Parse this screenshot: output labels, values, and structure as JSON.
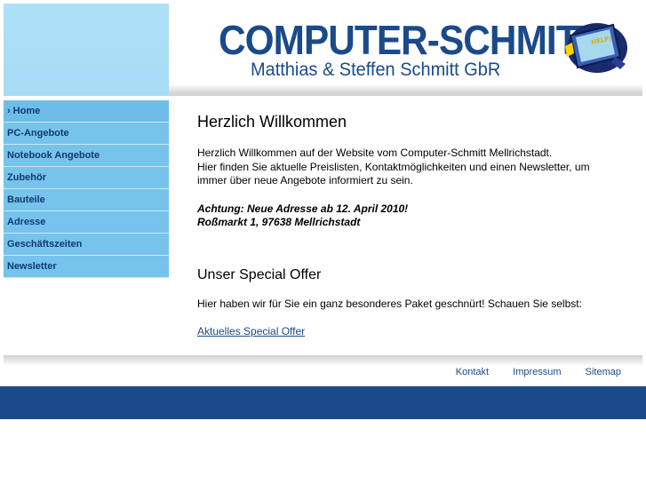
{
  "header": {
    "logo_title": "COMPUTER-SCHMITT",
    "logo_subtitle": "Matthias & Steffen Schmitt GbR",
    "mascot_label": "HELP!",
    "mascot_icon": "computer-mascot-icon"
  },
  "nav": {
    "items": [
      {
        "label": "Home",
        "active": true
      },
      {
        "label": "PC-Angebote"
      },
      {
        "label": "Notebook Angebote"
      },
      {
        "label": "Zubehör"
      },
      {
        "label": "Bauteile"
      },
      {
        "label": "Adresse"
      },
      {
        "label": "Geschäftszeiten"
      },
      {
        "label": "Newsletter"
      }
    ]
  },
  "content": {
    "welcome_title": "Herzlich Willkommen",
    "welcome_line1": "Herzlich Willkommen auf der Website vom Computer-Schmitt Mellrichstadt.",
    "welcome_line2": "Hier finden Sie aktuelle Preislisten, Kontaktmöglichkeiten und einen Newsletter, um immer über neue Angebote informiert zu sein.",
    "notice_line1": "Achtung: Neue Adresse ab 12. April 2010!",
    "notice_line2": "Roßmarkt 1, 97638 Mellrichstadt",
    "offer_title": "Unser Special Offer",
    "offer_text": "Hier haben wir für Sie ein ganz besonderes Paket geschnürt! Schauen Sie selbst:",
    "offer_link": "Aktuelles Special Offer"
  },
  "footer": {
    "links": [
      "Kontakt",
      "Impressum",
      "Sitemap"
    ]
  },
  "colors": {
    "brand": "#1a4a8a",
    "nav_bg": "#76c3ec",
    "header_light": "#aee0f8"
  }
}
